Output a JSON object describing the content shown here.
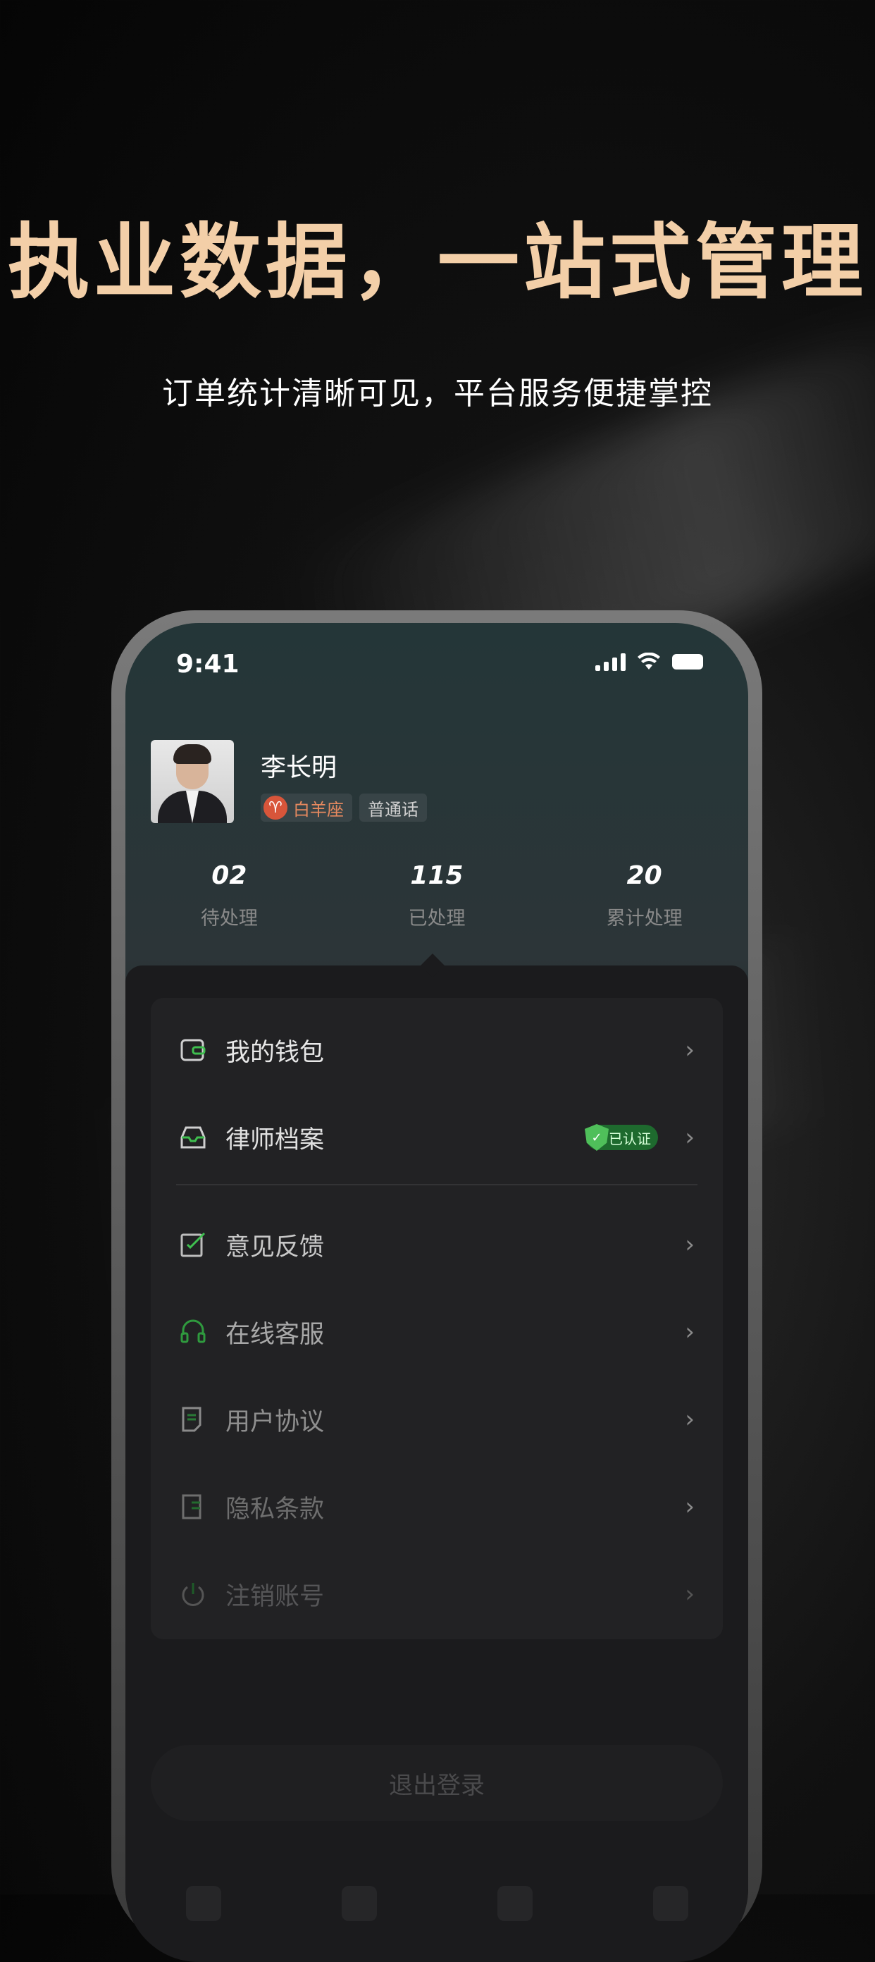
{
  "hero": {
    "title": "执业数据，一站式管理",
    "subtitle": "订单统计清晰可见，平台服务便捷掌控"
  },
  "status_bar": {
    "time": "9:41"
  },
  "profile": {
    "name": "李长明",
    "zodiac_symbol": "♈",
    "zodiac": "白羊座",
    "language": "普通话"
  },
  "stats": [
    {
      "value": "02",
      "label": "待处理"
    },
    {
      "value": "115",
      "label": "已处理"
    },
    {
      "value": "20",
      "label": "累计处理"
    }
  ],
  "menu": {
    "wallet": "我的钱包",
    "lawyer_profile": "律师档案",
    "verified_badge": "已认证",
    "feedback": "意见反馈",
    "customer_service": "在线客服",
    "user_agreement": "用户协议",
    "privacy": "隐私条款",
    "cancel_account": "注销账号"
  },
  "logout": "退出登录",
  "colors": {
    "accent": "#3fbf4f",
    "title_gold": "#f3cfa8"
  }
}
